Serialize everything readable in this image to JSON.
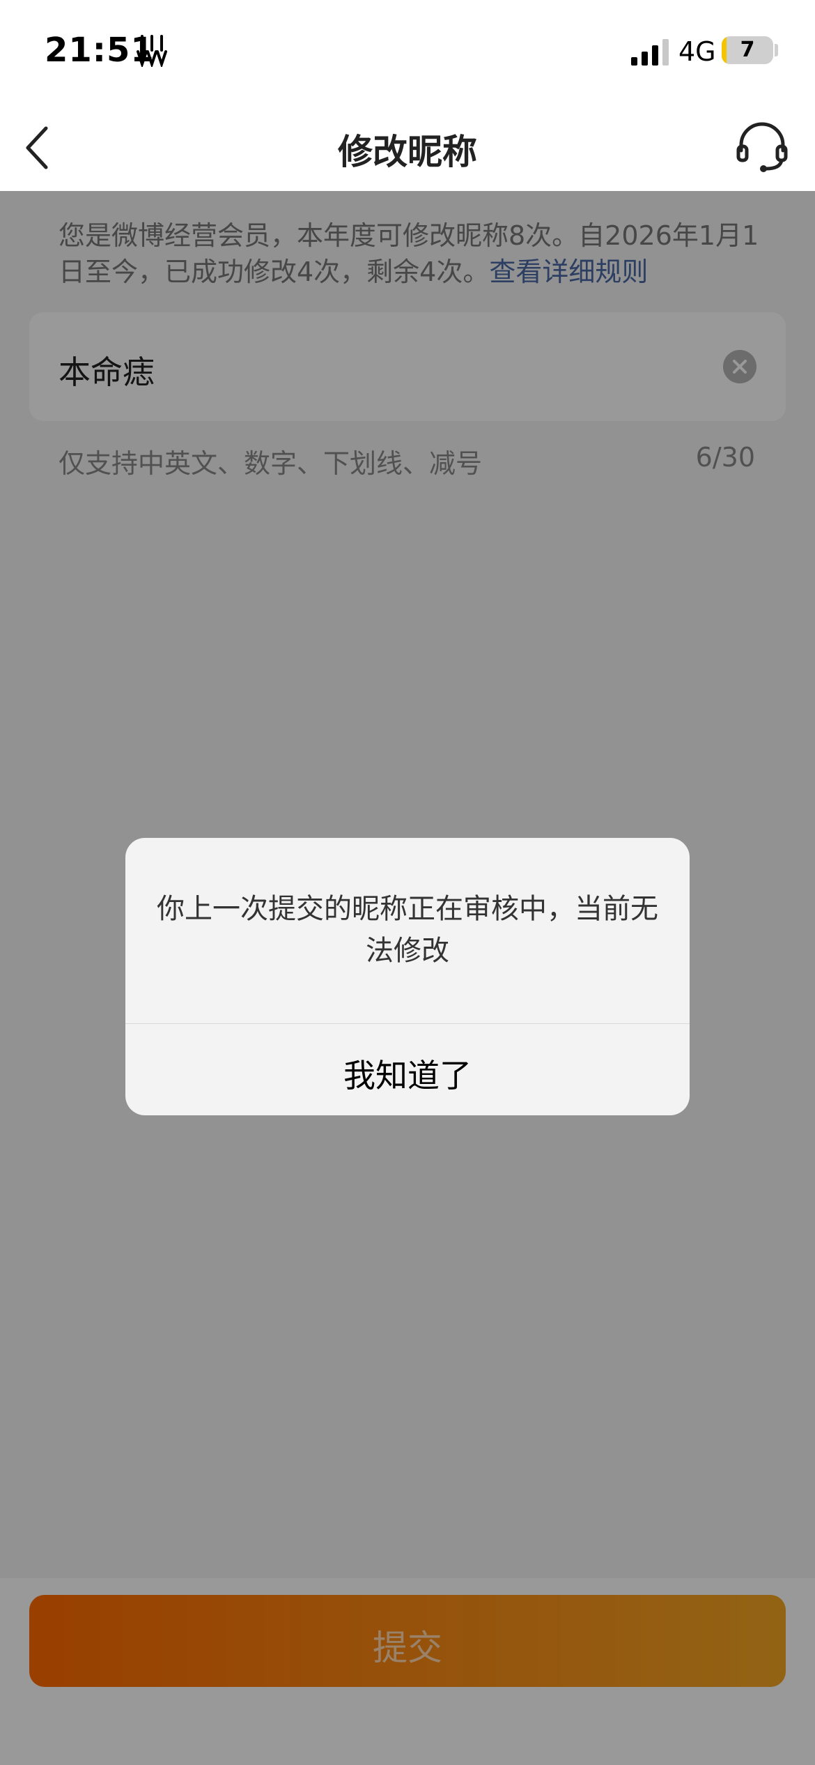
{
  "status_bar": {
    "time": "21:51",
    "network": "4G",
    "battery_level": "7"
  },
  "nav": {
    "title": "修改昵称"
  },
  "notice": {
    "text": "您是微博经营会员，本年度可修改昵称8次。自2026年1月1日至今，已成功修改4次，剩余4次。",
    "link": "查看详细规则"
  },
  "nickname_input": {
    "value": "本命痣"
  },
  "hint": "仅支持中英文、数字、下划线、减号",
  "counter": "6/30",
  "submit": {
    "label": "提交"
  },
  "dialog": {
    "message": "你上一次提交的昵称正在审核中，当前无法修改",
    "button": "我知道了"
  }
}
